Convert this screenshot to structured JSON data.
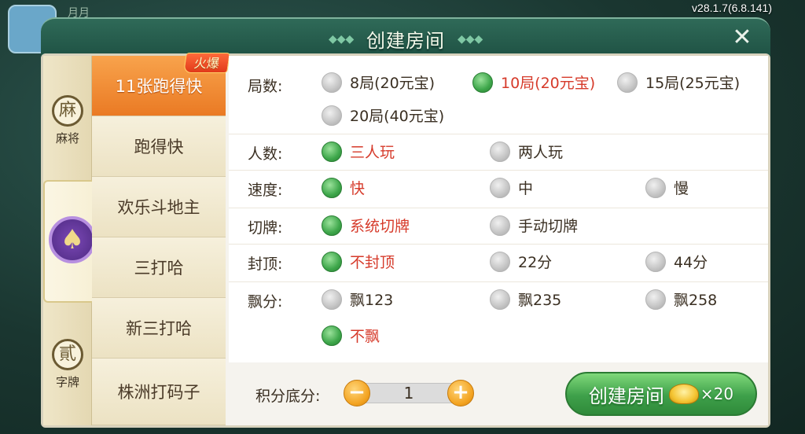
{
  "version": "v28.1.7(6.8.141)",
  "background": {
    "text": "月月"
  },
  "dialog": {
    "title": "创建房间",
    "close_icon": "close-icon"
  },
  "categories": [
    {
      "label": "麻将",
      "icon": "麻",
      "active": false
    },
    {
      "label": "",
      "icon": "♠",
      "active": true
    },
    {
      "label": "字牌",
      "icon": "貳",
      "active": false
    }
  ],
  "games": [
    {
      "label": "11张跑得快",
      "selected": true,
      "badge": "火爆"
    },
    {
      "label": "跑得快",
      "selected": false
    },
    {
      "label": "欢乐斗地主",
      "selected": false
    },
    {
      "label": "三打哈",
      "selected": false
    },
    {
      "label": "新三打哈",
      "selected": false
    },
    {
      "label": "株洲打码子",
      "selected": false
    }
  ],
  "rules": {
    "rounds": {
      "label": "局数:",
      "options": [
        "8局(20元宝)",
        "10局(20元宝)",
        "15局(25元宝)",
        "20局(40元宝)"
      ],
      "selected": 1
    },
    "players": {
      "label": "人数:",
      "options": [
        "三人玩",
        "两人玩"
      ],
      "selected": 0
    },
    "speed": {
      "label": "速度:",
      "options": [
        "快",
        "中",
        "慢"
      ],
      "selected": 0
    },
    "shuffle": {
      "label": "切牌:",
      "options": [
        "系统切牌",
        "手动切牌"
      ],
      "selected": 0
    },
    "cap": {
      "label": "封顶:",
      "options": [
        "不封顶",
        "22分",
        "44分"
      ],
      "selected": 0
    },
    "float": {
      "label": "飘分:",
      "options": [
        "飘123",
        "飘235",
        "飘258",
        "不飘"
      ],
      "selected": 3
    }
  },
  "score": {
    "label": "积分底分:",
    "value": "1",
    "minus": "−",
    "plus": "+"
  },
  "create": {
    "label": "创建房间",
    "cost": "×20"
  },
  "colors": {
    "selected_text": "#d63a2a",
    "radio_on": "#3da64a",
    "tab_selected": "#ea7a24",
    "create_button": "#3ea04a"
  }
}
